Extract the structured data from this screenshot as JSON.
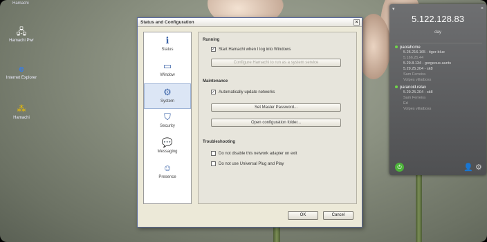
{
  "desktop": {
    "top_label": "Hamachi",
    "icons": [
      {
        "label": "Hamachi Pwr",
        "icon": "network-computer-icon"
      },
      {
        "label": "Internet Explorer",
        "icon": "ie-icon"
      },
      {
        "label": "Hamachi",
        "icon": "hamachi-icon"
      }
    ]
  },
  "dialog": {
    "title": "Status and Configuration",
    "close": "×",
    "sidebar": [
      {
        "label": "Status",
        "icon": "info-icon",
        "glyph": "ℹ"
      },
      {
        "label": "Window",
        "icon": "window-icon",
        "glyph": "▭"
      },
      {
        "label": "System",
        "icon": "gear-icon",
        "glyph": "⚙"
      },
      {
        "label": "Security",
        "icon": "shield-icon",
        "glyph": "⛉"
      },
      {
        "label": "Messaging",
        "icon": "speech-bubble-icon",
        "glyph": "💬"
      },
      {
        "label": "Presence",
        "icon": "presence-icon",
        "glyph": "☺"
      }
    ],
    "sections": {
      "running": "Running",
      "start_with_windows": "Start Hamachi when I log into Windows",
      "configure_button": "Configure Hamachi to run as a system service",
      "maintenance": "Maintenance",
      "auto_update": "Automatically update networks",
      "set_password_button": "Set Master Password...",
      "open_folder_button": "Open configuration folder...",
      "troubleshooting": "Troubleshooting",
      "no_disable": "Do not disable this network adapter on exit",
      "no_upnp": "Do not use Universal Plug and Play"
    },
    "ok": "OK",
    "cancel": "Cancel"
  },
  "status_panel": {
    "ip": "5.122.128.83",
    "status": "day",
    "networks": [
      {
        "name": "paolahome",
        "peers": [
          {
            "text": "5.25.216.165 - tiger-blue",
            "dim": false
          },
          {
            "text": "5.166.25.44",
            "dim": true
          },
          {
            "text": "5.29.8.134 - gorgeous-aunts",
            "dim": false
          },
          {
            "text": "5.29.25.204 - sk8",
            "dim": false
          },
          {
            "text": "Sam Ferreira",
            "dim": true
          },
          {
            "text": "Volpes villaiboss",
            "dim": true
          }
        ]
      },
      {
        "name": "paranoid.relax",
        "peers": [
          {
            "text": "5.29.25.204 - sk8",
            "dim": false
          },
          {
            "text": "Sam Ferreira",
            "dim": true
          },
          {
            "text": "Ed",
            "dim": true
          },
          {
            "text": "Volpes villaiboss",
            "dim": true
          }
        ]
      }
    ]
  }
}
